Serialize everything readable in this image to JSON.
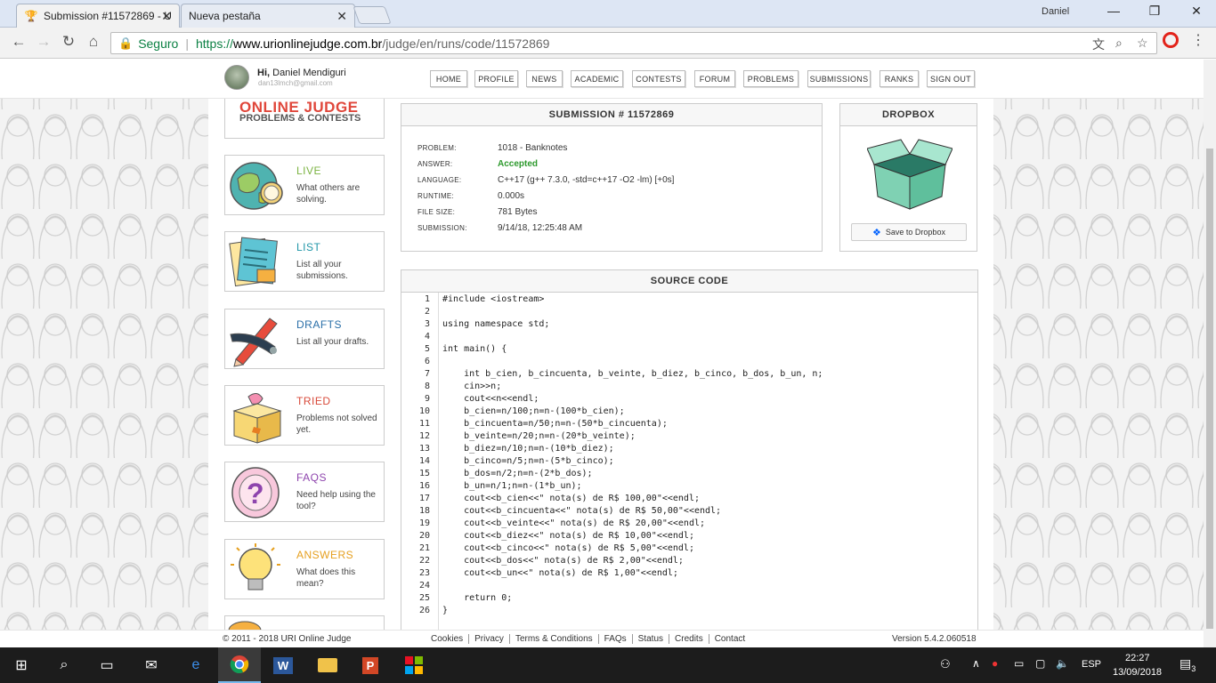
{
  "browser": {
    "tabs": [
      {
        "title": "Submission #11572869 - U",
        "active": true
      },
      {
        "title": "Nueva pestaña",
        "active": false
      }
    ],
    "user": "Daniel",
    "secure_label": "Seguro",
    "url_scheme": "https://",
    "url_domain": "www.urionlinejudge.com.br",
    "url_path": "/judge/en/runs/code/11572869"
  },
  "header": {
    "greeting_prefix": "Hi,",
    "user_name": "Daniel Mendiguri",
    "email": "dan13lmch@gmail.com",
    "nav": [
      "HOME",
      "PROFILE",
      "NEWS",
      "ACADEMIC",
      "CONTESTS",
      "FORUM",
      "PROBLEMS",
      "SUBMISSIONS",
      "RANKS",
      "SIGN OUT"
    ]
  },
  "sidebar": {
    "logo_title": "ONLINE JUDGE",
    "logo_subtitle": "PROBLEMS & CONTESTS",
    "cards": [
      {
        "title": "LIVE",
        "desc": "What others are solving.",
        "color": "#7cb342",
        "icon": "globe-icon"
      },
      {
        "title": "LIST",
        "desc": "List all your submissions.",
        "color": "#2196a8",
        "icon": "list-icon"
      },
      {
        "title": "DRAFTS",
        "desc": "List all your drafts.",
        "color": "#2a6fa8",
        "icon": "pencil-icon"
      },
      {
        "title": "TRIED",
        "desc": "Problems not solved yet.",
        "color": "#d84a3a",
        "icon": "box-icon"
      },
      {
        "title": "FAQS",
        "desc": "Need help using the tool?",
        "color": "#8e44ad",
        "icon": "question-icon"
      },
      {
        "title": "ANSWERS",
        "desc": "What does this mean?",
        "color": "#e6a020",
        "icon": "lightbulb-icon"
      }
    ]
  },
  "submission": {
    "heading": "SUBMISSION # 11572869",
    "rows": [
      {
        "label": "PROBLEM:",
        "value": "1018 - Banknotes"
      },
      {
        "label": "ANSWER:",
        "value": "Accepted"
      },
      {
        "label": "LANGUAGE:",
        "value": "C++17 (g++ 7.3.0, -std=c++17 -O2 -lm) [+0s]"
      },
      {
        "label": "RUNTIME:",
        "value": "0.000s"
      },
      {
        "label": "FILE SIZE:",
        "value": "781 Bytes"
      },
      {
        "label": "SUBMISSION:",
        "value": "9/14/18, 12:25:48 AM"
      }
    ],
    "accepted_color": "#2e9a2e"
  },
  "dropbox": {
    "heading": "DROPBOX",
    "button": "Save to Dropbox"
  },
  "source": {
    "heading": "SOURCE CODE",
    "lines": [
      "#include <iostream>",
      "",
      "using namespace std;",
      "",
      "int main() {",
      "",
      "    int b_cien, b_cincuenta, b_veinte, b_diez, b_cinco, b_dos, b_un, n;",
      "    cin>>n;",
      "    cout<<n<<endl;",
      "    b_cien=n/100;n=n-(100*b_cien);",
      "    b_cincuenta=n/50;n=n-(50*b_cincuenta);",
      "    b_veinte=n/20;n=n-(20*b_veinte);",
      "    b_diez=n/10;n=n-(10*b_diez);",
      "    b_cinco=n/5;n=n-(5*b_cinco);",
      "    b_dos=n/2;n=n-(2*b_dos);",
      "    b_un=n/1;n=n-(1*b_un);",
      "    cout<<b_cien<<\" nota(s) de R$ 100,00\"<<endl;",
      "    cout<<b_cincuenta<<\" nota(s) de R$ 50,00\"<<endl;",
      "    cout<<b_veinte<<\" nota(s) de R$ 20,00\"<<endl;",
      "    cout<<b_diez<<\" nota(s) de R$ 10,00\"<<endl;",
      "    cout<<b_cinco<<\" nota(s) de R$ 5,00\"<<endl;",
      "    cout<<b_dos<<\" nota(s) de R$ 2,00\"<<endl;",
      "    cout<<b_un<<\" nota(s) de R$ 1,00\"<<endl;",
      "",
      "    return 0;",
      "}"
    ]
  },
  "footer": {
    "copyright": "© 2011 - 2018 URI Online Judge",
    "links": [
      "Cookies",
      "Privacy",
      "Terms & Conditions",
      "FAQs",
      "Status",
      "Credits",
      "Contact"
    ],
    "version": "Version 5.4.2.060518"
  },
  "taskbar": {
    "language": "ESP",
    "time": "22:27",
    "date": "13/09/2018",
    "notifications": "3"
  }
}
